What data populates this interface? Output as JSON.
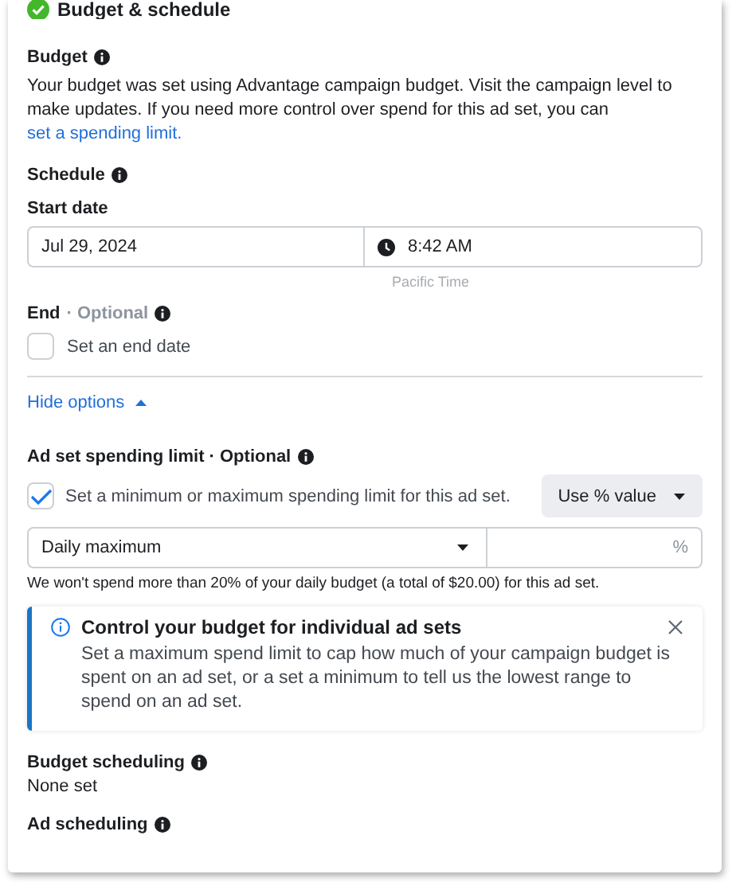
{
  "header": {
    "title": "Budget & schedule",
    "complete": true
  },
  "budget": {
    "label": "Budget",
    "text": "Your budget was set using Advantage campaign budget. Visit the campaign level to make updates. If you need more control over spend for this ad set, you can ",
    "link": "set a spending limit."
  },
  "schedule": {
    "label": "Schedule",
    "start_label": "Start date",
    "date": "Jul 29, 2024",
    "time": "8:42 AM",
    "timezone": "Pacific Time",
    "end_label": "End",
    "end_optional": "· Optional",
    "end_checkbox": {
      "label": "Set an end date",
      "checked": false
    }
  },
  "toggle": {
    "label": "Hide options",
    "expanded": true
  },
  "spending_limit": {
    "label": "Ad set spending limit · Optional",
    "checkbox": {
      "label": "Set a minimum or maximum spending limit for this ad set.",
      "checked": true
    },
    "mode": "Use % value",
    "limit_type": "Daily maximum",
    "unit": "%",
    "note": "We won't spend more than 20% of your daily budget (a total of $20.00) for this ad set."
  },
  "callout": {
    "title": "Control your budget for individual ad sets",
    "body": "Set a maximum spend limit to cap how much of your campaign budget is spent on an ad set, or a set a minimum to tell us the lowest range to spend on an ad set."
  },
  "budget_scheduling": {
    "label": "Budget scheduling",
    "value": "None set"
  },
  "ad_scheduling": {
    "label": "Ad scheduling"
  }
}
